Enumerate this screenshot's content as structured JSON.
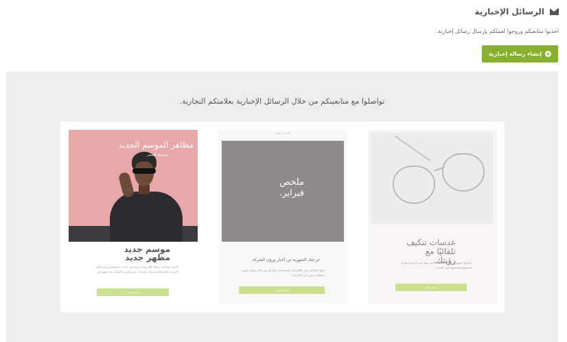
{
  "header": {
    "title": "الرسائل الإخبارية",
    "icon": "envelope-icon"
  },
  "subtitle": "اجذبوا متابعيكم وروجوا لعملكم بإرسال رسائل إخبارية.",
  "create_button": {
    "label": "إنشاء رسالة إخبارية",
    "icon": "plus-circle-icon",
    "color": "#86b02d"
  },
  "hero": {
    "heading": "تواصلوا مع متابعينكم من خلال الرسائل الإخبارية بعلامتكم التجارية."
  },
  "templates": [
    {
      "overlay_title": "مظاهر الموسم الجديد",
      "overlay_subtitle": "مجموعة المتجر",
      "headline": "موسم جديد مظهر جديد",
      "body": "أخبروا عملاءكم برسالة إلكترونية تعريفية عن أحدث منتجاتكم أو عروضكم الجديدة. كما يمكنكم إرسال تحديثات دورية لتعزيز التواصل مع جمهوركم.",
      "button_label": "تسوق الآن",
      "image_color": "#e8a8aa"
    },
    {
      "topbar": "لجديد عن متجرنا",
      "image_text": "ملخص فبراير.",
      "headline": "جرعتك الشهرية من أخبار ورؤى الشركة.",
      "body": "ابقوا عملاءكم على اطلاع بآخر المستجدات والأخبار من خلال رسالة شهرية منتظمة تعرض أبرز الإنجازات.",
      "button_label": "قراءة المزيد",
      "image_color": "#8e8a8e"
    },
    {
      "headline": "عدسات تتكيف تلقائيًا مع رؤيتك.",
      "body": "شاركوا جمهوركم رسالة مخصصة عن منتج جديد أو ميزة مميزة تقدمونها لتشجيعهم على الشراء.",
      "button_label": "اشتر الآن"
    }
  ]
}
